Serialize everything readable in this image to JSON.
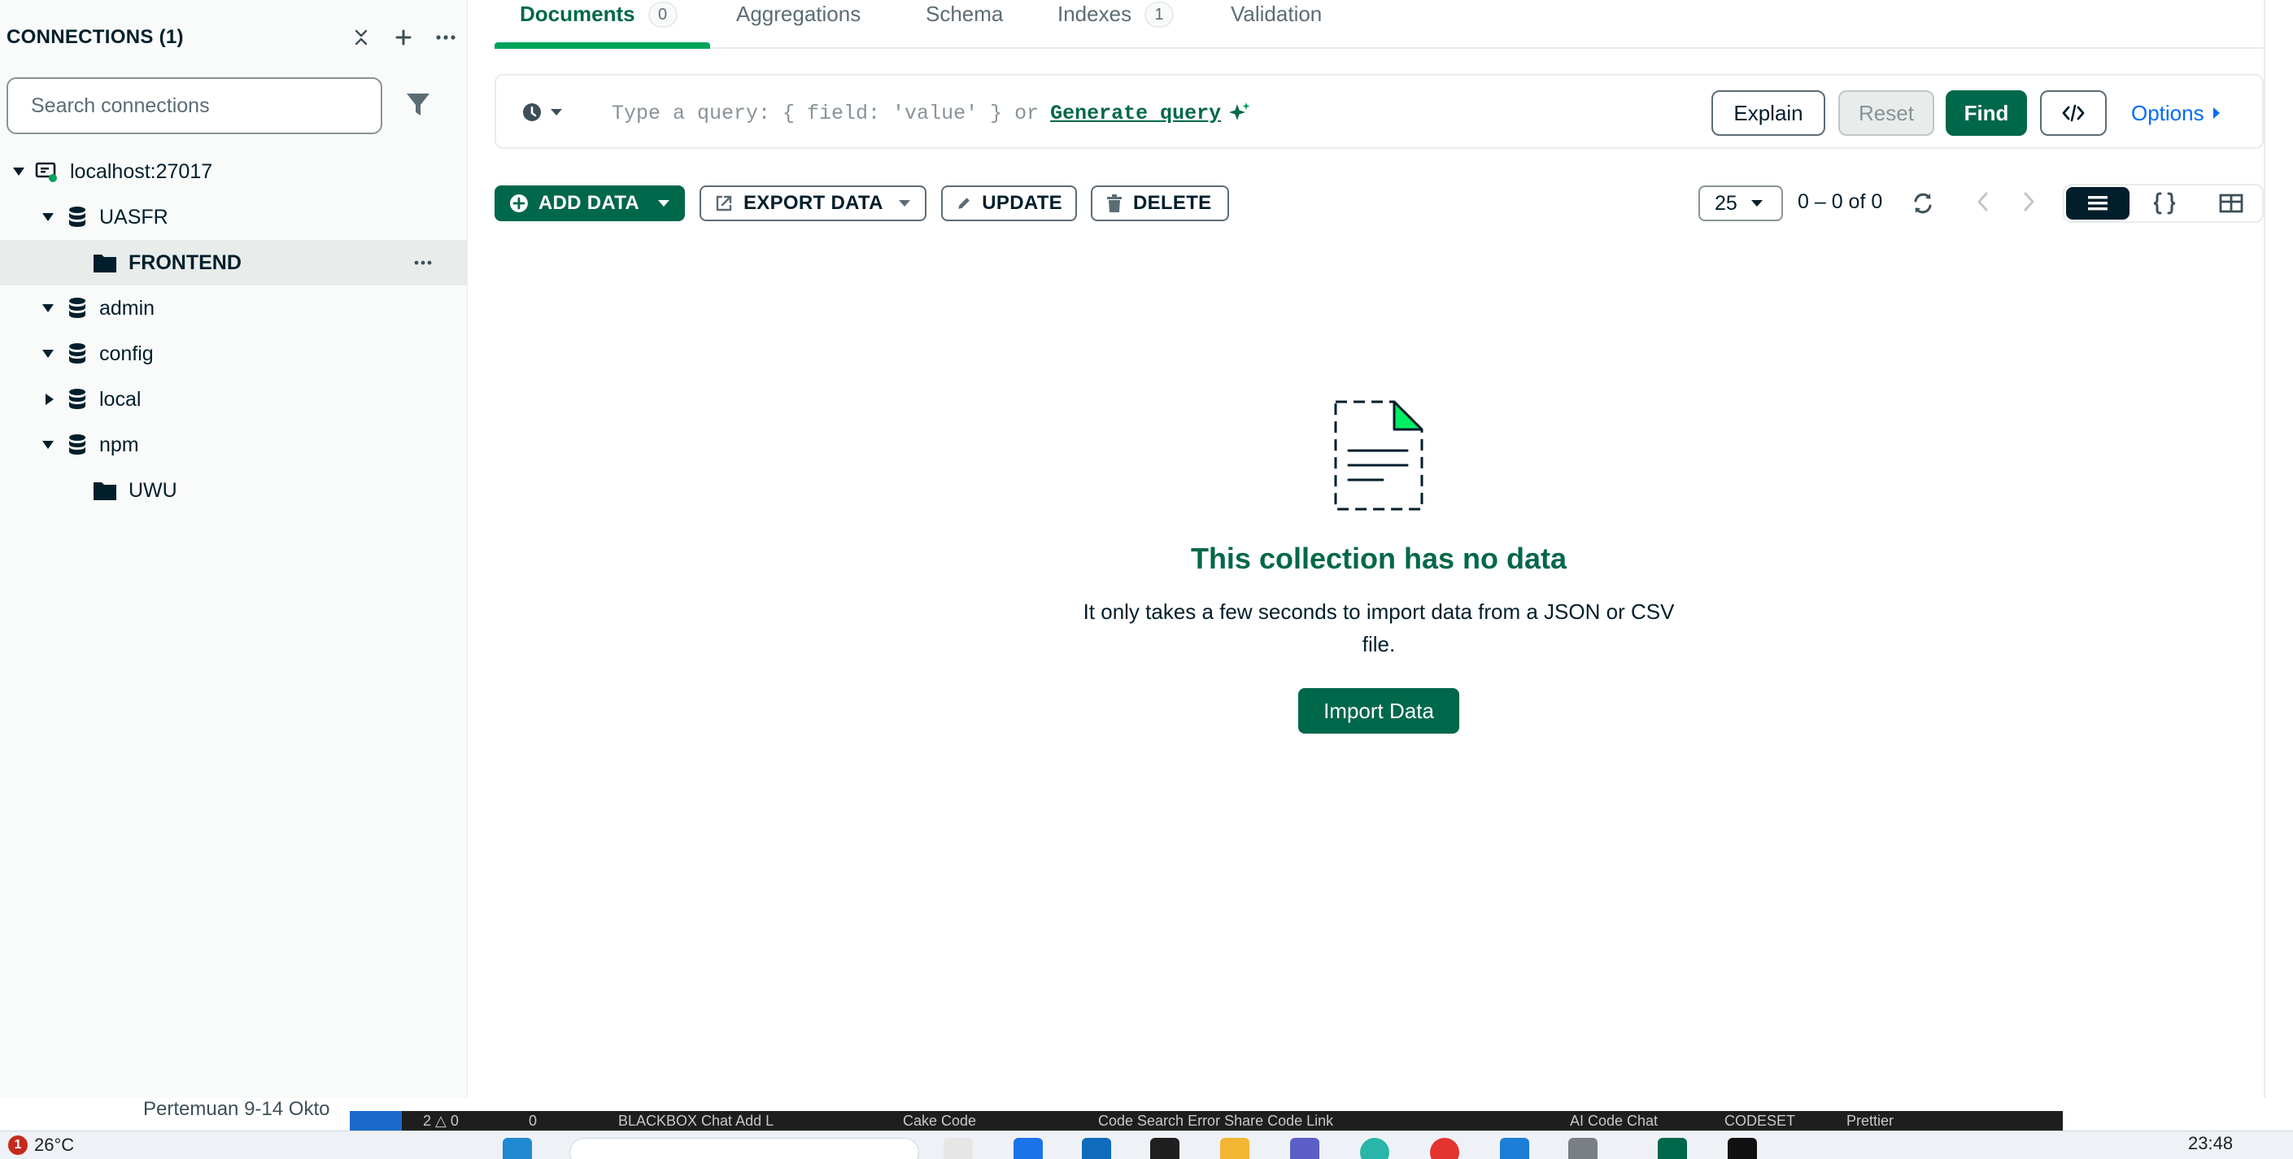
{
  "sidebar": {
    "title": "CONNECTIONS (1)",
    "search_placeholder": "Search connections",
    "tree": [
      {
        "label": "localhost:27017",
        "kind": "connection"
      },
      {
        "label": "UASFR",
        "kind": "database",
        "expanded": true
      },
      {
        "label": "FRONTEND",
        "kind": "collection",
        "selected": true
      },
      {
        "label": "admin",
        "kind": "database",
        "expanded": true
      },
      {
        "label": "config",
        "kind": "database",
        "expanded": true
      },
      {
        "label": "local",
        "kind": "database",
        "expanded": false
      },
      {
        "label": "npm",
        "kind": "database",
        "expanded": true
      },
      {
        "label": "UWU",
        "kind": "collection"
      }
    ]
  },
  "tabs": [
    {
      "label": "Documents",
      "count": "0",
      "active": true
    },
    {
      "label": "Aggregations"
    },
    {
      "label": "Schema"
    },
    {
      "label": "Indexes",
      "count": "1"
    },
    {
      "label": "Validation"
    }
  ],
  "query": {
    "placeholder": "Type a query: { field: 'value' } or",
    "generate_link": "Generate query",
    "explain": "Explain",
    "reset": "Reset",
    "find": "Find",
    "options": "Options"
  },
  "toolbar": {
    "add_data": "ADD DATA",
    "export_data": "EXPORT DATA",
    "update": "UPDATE",
    "delete": "DELETE",
    "page_size": "25",
    "range": "0 – 0 of 0"
  },
  "empty_state": {
    "title": "This collection has no data",
    "description": "It only takes a few seconds to import data from a JSON or CSV file.",
    "button": "Import Data"
  },
  "background": {
    "window_text": "Pertemuan 9-14 Okto",
    "status_items": [
      "2 △ 0",
      "0",
      "BLACKBOX Chat   Add L",
      "Cake Code",
      "Code   Search Error   Share Code Link",
      "AI Code Chat",
      "CODESET",
      "Prettier"
    ]
  },
  "taskbar": {
    "badge": "1",
    "temperature": "26°C",
    "time": "23:48"
  },
  "colors": {
    "brand_green": "#00684a",
    "accent_green": "#00a35c",
    "link_blue": "#016bf8",
    "ink": "#001e2b"
  }
}
